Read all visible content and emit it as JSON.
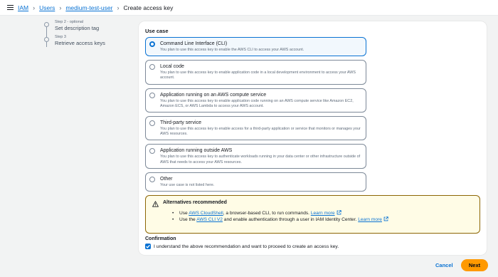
{
  "breadcrumb": {
    "items": [
      "IAM",
      "Users",
      "medium-test-user"
    ],
    "current": "Create access key"
  },
  "steps": [
    {
      "label": "Step 2 - optional",
      "title": "Set description tag"
    },
    {
      "label": "Step 3",
      "title": "Retrieve access keys"
    }
  ],
  "use_case": {
    "title": "Use case",
    "options": [
      {
        "title": "Command Line Interface (CLI)",
        "desc": "You plan to use this access key to enable the AWS CLI to access your AWS account.",
        "selected": true
      },
      {
        "title": "Local code",
        "desc": "You plan to use this access key to enable application code in a local development environment to access your AWS account.",
        "selected": false
      },
      {
        "title": "Application running on an AWS compute service",
        "desc": "You plan to use this access key to enable application code running on an AWS compute service like Amazon EC2, Amazon ECS, or AWS Lambda to access your AWS account.",
        "selected": false
      },
      {
        "title": "Third-party service",
        "desc": "You plan to use this access key to enable access for a third-party application or service that monitors or manages your AWS resources.",
        "selected": false
      },
      {
        "title": "Application running outside AWS",
        "desc": "You plan to use this access key to authenticate workloads running in your data center or other infrastructure outside of AWS that needs to access your AWS resources.",
        "selected": false
      },
      {
        "title": "Other",
        "desc": "Your use case is not listed here.",
        "selected": false
      }
    ]
  },
  "alert": {
    "title": "Alternatives recommended",
    "line1_prefix": "Use ",
    "line1_link": "AWS CloudShell",
    "line1_text": ", a browser-based CLI, to run commands. ",
    "line1_learn": "Learn more",
    "line2_prefix": "Use the ",
    "line2_link": "AWS CLI V2",
    "line2_text": " and enable authentication through a user in IAM Identity Center. ",
    "line2_learn": "Learn more"
  },
  "confirmation": {
    "title": "Confirmation",
    "checkbox_label": "I understand the above recommendation and want to proceed to create an access key.",
    "checked": true
  },
  "actions": {
    "cancel": "Cancel",
    "next": "Next"
  },
  "colors": {
    "accent": "#0972d3",
    "primary_button": "#ff9900",
    "warning_border": "#8d6605",
    "warning_bg": "#fffce6"
  }
}
